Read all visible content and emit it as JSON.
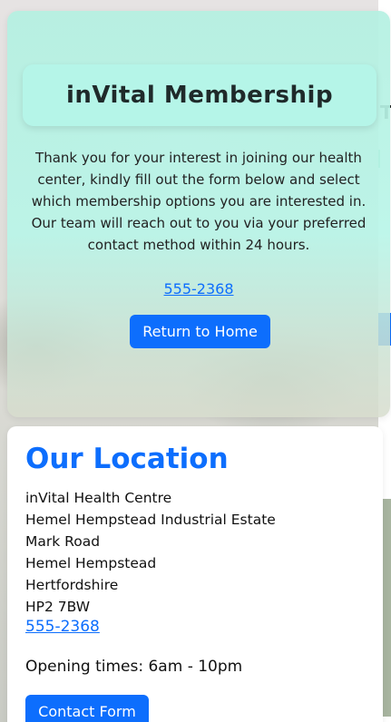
{
  "hero": {
    "title": "inVital Membership",
    "text": "Thank you for your interest in joining our health center, kindly fill out the form below and select which membership options you are interested in. Our team will reach out to you via your preferred contact method within 24 hours.",
    "phone": "555-2368",
    "return_label": "Return to Home"
  },
  "location": {
    "title": "Our Location",
    "address": [
      "inVital Health Centre",
      "Hemel Hempstead Industrial Estate",
      "Mark Road",
      "Hemel Hempstead",
      "Hertfordshire",
      "HP2 7BW"
    ],
    "phone": "555-2368",
    "hours": "Opening times: 6am - 10pm",
    "contact_label": "Contact Form"
  },
  "colors": {
    "accent": "#0d6efd",
    "hero_bg": "#b5f5e8"
  }
}
